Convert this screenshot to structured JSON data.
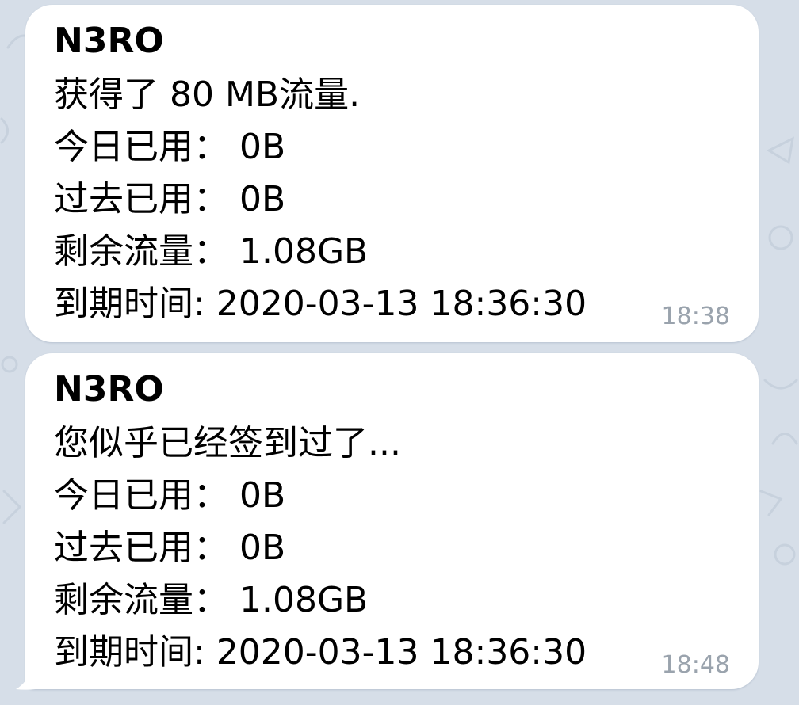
{
  "colors": {
    "chat_background": "#d6dee8",
    "bubble": "#ffffff",
    "text": "#000000",
    "timestamp": "#9aa3ad"
  },
  "messages": [
    {
      "sender": "N3RO",
      "lines": [
        "获得了 80 MB流量.",
        "今日已用： 0B",
        "过去已用： 0B",
        "剩余流量： 1.08GB",
        "到期时间: 2020-03-13 18:36:30"
      ],
      "time": "18:38"
    },
    {
      "sender": "N3RO",
      "lines": [
        "您似乎已经签到过了...",
        "今日已用： 0B",
        "过去已用： 0B",
        "剩余流量： 1.08GB",
        "到期时间: 2020-03-13 18:36:30"
      ],
      "time": "18:48"
    }
  ]
}
